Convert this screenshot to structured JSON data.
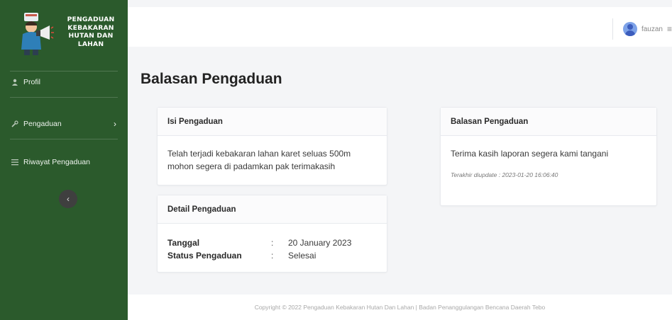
{
  "brand": {
    "lines": [
      "PENGADUAN",
      "KEBAKARAN",
      "HUTAN DAN",
      "LAHAN"
    ]
  },
  "sidebar": {
    "items": [
      {
        "label": "Profil",
        "icon": "user-icon"
      },
      {
        "label": "Pengaduan",
        "icon": "wrench-icon",
        "has_submenu": true
      },
      {
        "label": "Riwayat Pengaduan",
        "icon": "list-icon"
      }
    ]
  },
  "topbar": {
    "username": "fauzan"
  },
  "page": {
    "title": "Balasan Pengaduan"
  },
  "isi_card": {
    "title": "Isi Pengaduan",
    "text": "Telah terjadi kebakaran lahan karet seluas 500m mohon segera di padamkan pak terimakasih"
  },
  "detail_card": {
    "title": "Detail Pengaduan",
    "rows": [
      {
        "label": "Tanggal",
        "colon": ":",
        "value": "20 January 2023"
      },
      {
        "label": "Status Pengaduan",
        "colon": ":",
        "value": "Selesai"
      }
    ]
  },
  "balasan_card": {
    "title": "Balasan Pengaduan",
    "text": "Terima kasih laporan segera kami tangani",
    "updated": "Terakhir diupdate : 2023-01-20 16:06:40"
  },
  "footer": {
    "text": "Copyright © 2022 Pengaduan Kebakaran Hutan Dan Lahan | Badan Penanggulangan Bencana Daerah Tebo"
  },
  "colors": {
    "sidebar": "#2b5a2c",
    "background": "#f4f5f7",
    "card": "#ffffff"
  }
}
